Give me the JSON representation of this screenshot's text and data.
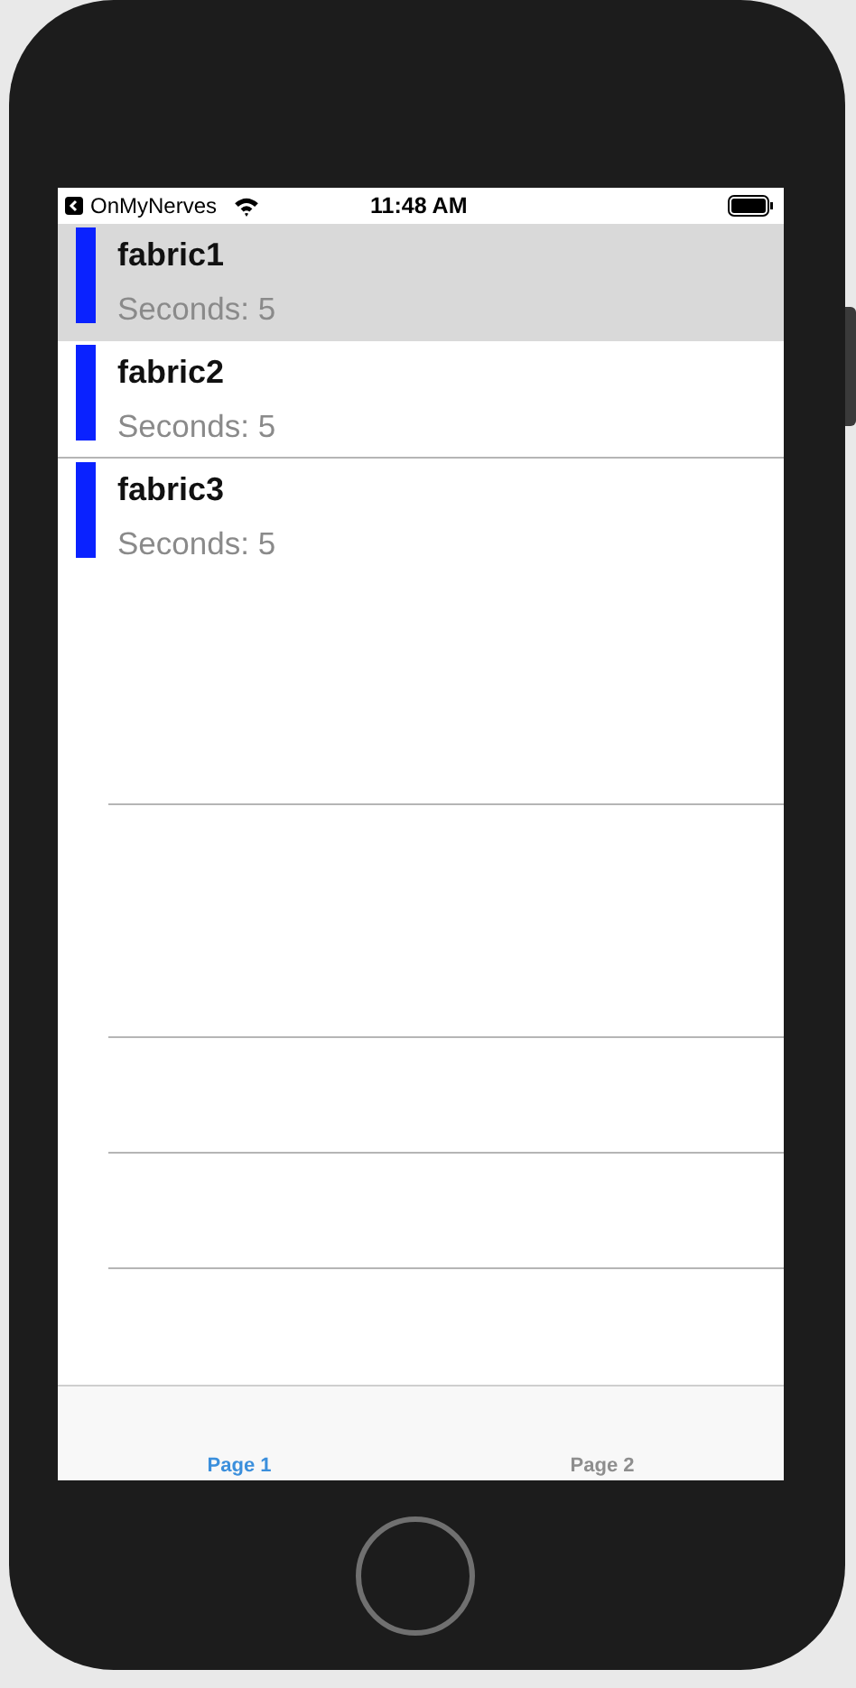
{
  "status_bar": {
    "back_app": "OnMyNerves",
    "time": "11:48 AM"
  },
  "list": [
    {
      "title": "fabric1",
      "subtitle": "Seconds: 5",
      "selected": true
    },
    {
      "title": "fabric2",
      "subtitle": "Seconds: 5",
      "selected": false
    },
    {
      "title": "fabric3",
      "subtitle": "Seconds: 5",
      "selected": false
    }
  ],
  "tabs": [
    {
      "label": "Page 1",
      "selected": true
    },
    {
      "label": "Page 2",
      "selected": false
    }
  ]
}
